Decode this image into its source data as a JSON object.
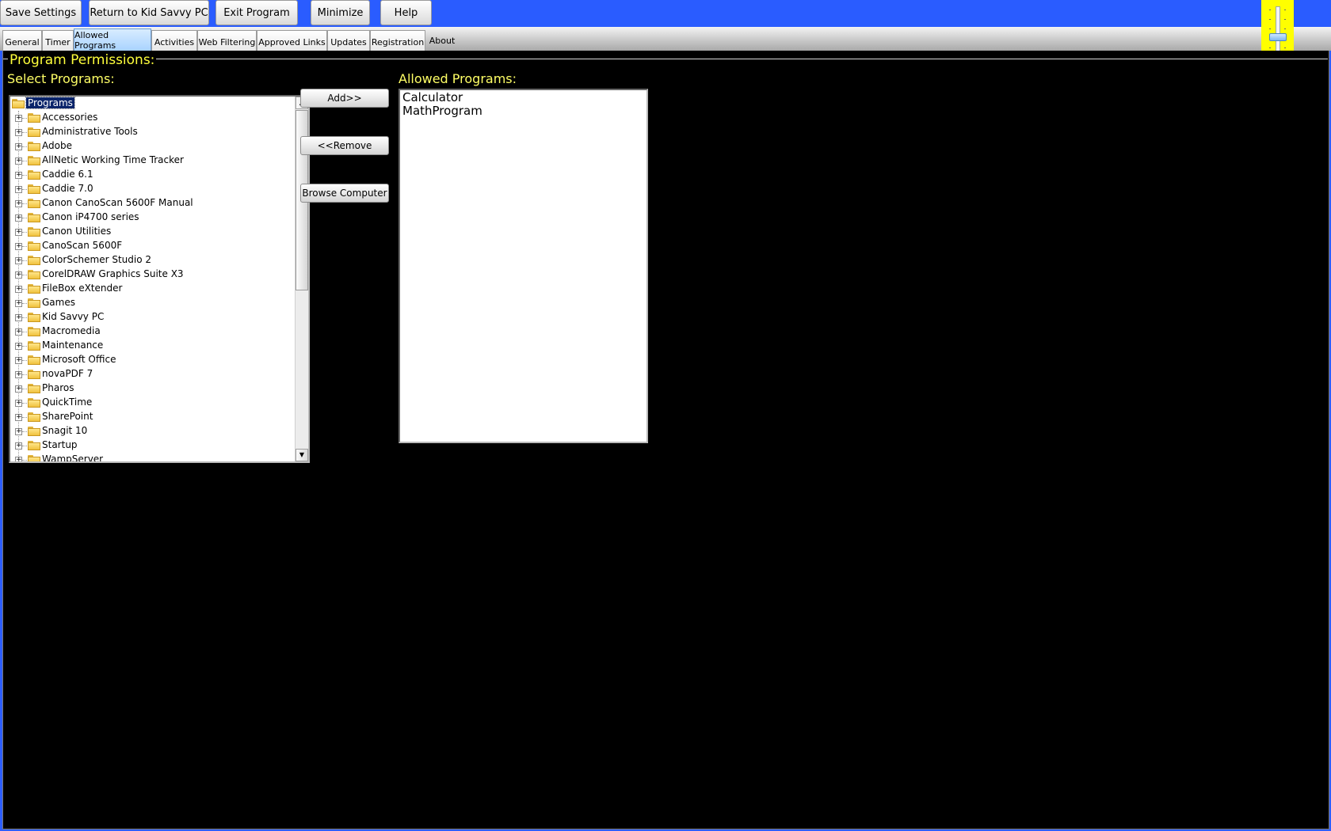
{
  "toolbar": {
    "buttons": [
      {
        "label": "Save Settings"
      },
      {
        "label": "Return to Kid Savvy PC"
      },
      {
        "label": "Exit Program"
      },
      {
        "label": "Minimize"
      },
      {
        "label": "Help"
      }
    ]
  },
  "tabs": [
    {
      "label": "General"
    },
    {
      "label": "Timer"
    },
    {
      "label": "Allowed Programs",
      "active": true
    },
    {
      "label": "Activities"
    },
    {
      "label": "Web Filtering"
    },
    {
      "label": "Approved Links"
    },
    {
      "label": "Updates"
    },
    {
      "label": "Registration"
    },
    {
      "label": "About"
    }
  ],
  "main": {
    "group_title": "Program Permissions:",
    "select_label": "Select Programs:",
    "allowed_label": "Allowed Programs:",
    "tree": {
      "root": "Programs",
      "items": [
        "Accessories",
        "Administrative Tools",
        "Adobe",
        "AllNetic Working Time Tracker",
        "Caddie 6.1",
        "Caddie 7.0",
        "Canon CanoScan 5600F Manual",
        "Canon iP4700 series",
        "Canon Utilities",
        "CanoScan 5600F",
        "ColorSchemer Studio 2",
        "CorelDRAW Graphics Suite X3",
        "FileBox eXtender",
        "Games",
        "Kid Savvy PC",
        "Macromedia",
        "Maintenance",
        "Microsoft Office",
        "novaPDF 7",
        "Pharos",
        "QuickTime",
        "SharePoint",
        "Snagit 10",
        "Startup",
        "WampServer"
      ]
    },
    "actions": {
      "add": "Add>>",
      "remove": "<<Remove",
      "browse": "Browse Computer"
    },
    "allowed_programs": [
      "Calculator",
      "MathProgram"
    ]
  },
  "colors": {
    "toolbar_bg": "#2a5cff",
    "main_bg": "#000000",
    "label_yellow": "#ffff66",
    "slider_highlight": "#ffff00",
    "tab_active": "#a9d3ff"
  }
}
